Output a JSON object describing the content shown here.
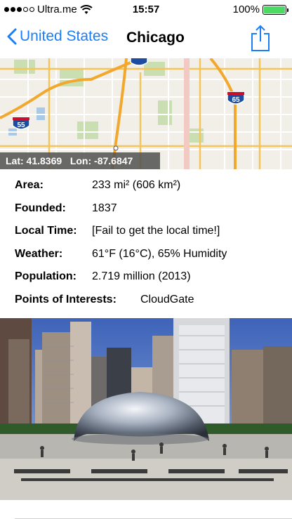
{
  "status_bar": {
    "carrier": "Ultra.me",
    "time": "15:57",
    "battery": "100%",
    "signal_bars_on": 3,
    "signal_bars_total": 5,
    "battery_level": 1.0,
    "battery_color": "#4cd964"
  },
  "nav": {
    "back_label": "United States",
    "title": "Chicago",
    "accent": "#1a7ef7",
    "share_icon": "share-icon"
  },
  "map": {
    "coords_text": "Lat: 41.8369   Lon: -87.6847",
    "shields": [
      "55",
      "65"
    ]
  },
  "info": {
    "area": {
      "label": "Area:",
      "value": "233 mi² (606 km²)"
    },
    "founded": {
      "label": "Founded:",
      "value": "1837"
    },
    "local_time": {
      "label": "Local Time:",
      "value": "[Fail to get the local time!]"
    },
    "weather": {
      "label": "Weather:",
      "value": "61°F (16°C), 65% Humidity"
    },
    "population": {
      "label": "Population:",
      "value": "2.719 million (2013)"
    },
    "poi": {
      "label": "Points of Interests:",
      "value": "CloudGate"
    }
  }
}
